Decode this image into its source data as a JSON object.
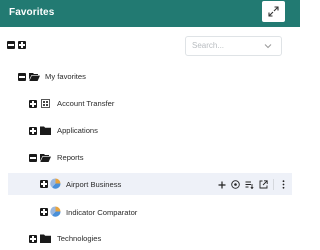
{
  "header": {
    "title": "Favorites",
    "color": "#227a72"
  },
  "search": {
    "placeholder": "Search..."
  },
  "tree": {
    "root": {
      "label": "My favorites"
    },
    "items": [
      {
        "label": "Account Transfer",
        "icon": "dashboard-icon"
      },
      {
        "label": "Applications",
        "icon": "folder-icon"
      },
      {
        "label": "Reports",
        "icon": "folder-open-icon"
      },
      {
        "label": "Airport Business",
        "icon": "chart-icon",
        "selected": true
      },
      {
        "label": "Indicator Comparator",
        "icon": "chart-icon"
      },
      {
        "label": "Technologies",
        "icon": "folder-icon"
      }
    ]
  },
  "row_actions": [
    "add-icon",
    "info-icon",
    "sort-icon",
    "open-external-icon",
    "more-icon"
  ]
}
